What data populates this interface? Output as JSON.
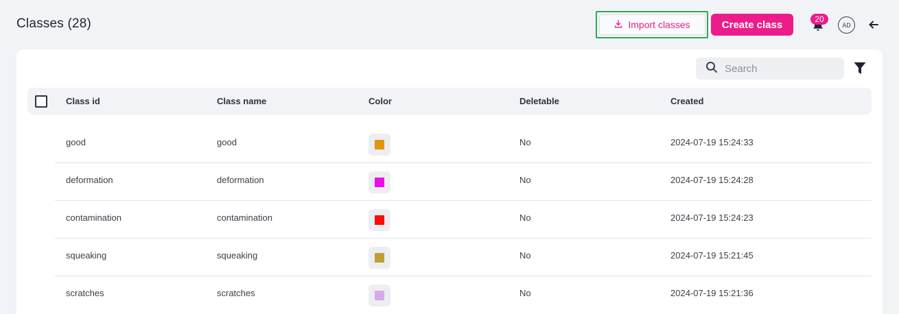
{
  "header": {
    "title": "Classes (28)",
    "import_label": "Import classes",
    "create_label": "Create class",
    "notification_count": "20",
    "avatar_initials": "AD"
  },
  "toolbar": {
    "search_placeholder": "Search"
  },
  "table": {
    "columns": [
      "Class id",
      "Class name",
      "Color",
      "Deletable",
      "Created"
    ],
    "rows": [
      {
        "id": "good",
        "name": "good",
        "color": "#e0960f",
        "deletable": "No",
        "created": "2024-07-19 15:24:33"
      },
      {
        "id": "deformation",
        "name": "deformation",
        "color": "#ee0ee8",
        "deletable": "No",
        "created": "2024-07-19 15:24:28"
      },
      {
        "id": "contamination",
        "name": "contamination",
        "color": "#ff0a0a",
        "deletable": "No",
        "created": "2024-07-19 15:24:23"
      },
      {
        "id": "squeaking",
        "name": "squeaking",
        "color": "#bf9f33",
        "deletable": "No",
        "created": "2024-07-19 15:21:45"
      },
      {
        "id": "scratches",
        "name": "scratches",
        "color": "#d8a9e6",
        "deletable": "No",
        "created": "2024-07-19 15:21:36"
      }
    ]
  },
  "colors": {
    "accent": "#ec1c8b",
    "highlight": "#34a853",
    "background": "#f2f3f7"
  },
  "icons": {
    "import": "download-icon",
    "notifications": "bell-icon",
    "back": "arrow-left-icon",
    "search": "search-icon",
    "filter": "filter-icon"
  }
}
